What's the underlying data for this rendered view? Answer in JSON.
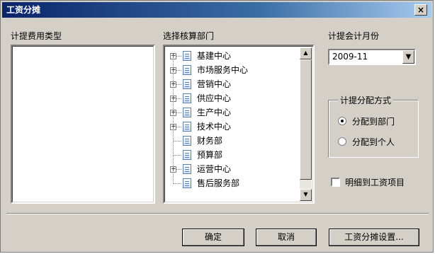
{
  "window": {
    "title": "工资分摊",
    "close_label": "×"
  },
  "left_panel": {
    "label": "计提费用类型"
  },
  "middle_panel": {
    "label": "选择核算部门",
    "tree_items": [
      {
        "label": "基建中心",
        "expandable": true
      },
      {
        "label": "市场服务中心",
        "expandable": true
      },
      {
        "label": "营销中心",
        "expandable": true
      },
      {
        "label": "供应中心",
        "expandable": true
      },
      {
        "label": "生产中心",
        "expandable": true
      },
      {
        "label": "技术中心",
        "expandable": true
      },
      {
        "label": "财务部",
        "expandable": false
      },
      {
        "label": "预算部",
        "expandable": false
      },
      {
        "label": "运营中心",
        "expandable": true
      },
      {
        "label": "售后服务部",
        "expandable": false
      }
    ],
    "scroll_up_icon": "▲",
    "scroll_down_icon": "▼"
  },
  "right_panel": {
    "month_label": "计提会计月份",
    "month_value": "2009-11",
    "dropdown_icon": "▼",
    "distribution": {
      "title": "计提分配方式",
      "options": [
        {
          "label": "分配到部门",
          "checked": true
        },
        {
          "label": "分配到个人",
          "checked": false
        }
      ]
    },
    "detail_checkbox": {
      "label": "明细到工资项目",
      "checked": false
    }
  },
  "buttons": {
    "ok": "确定",
    "cancel": "取消",
    "settings": "工资分摊设置..."
  }
}
